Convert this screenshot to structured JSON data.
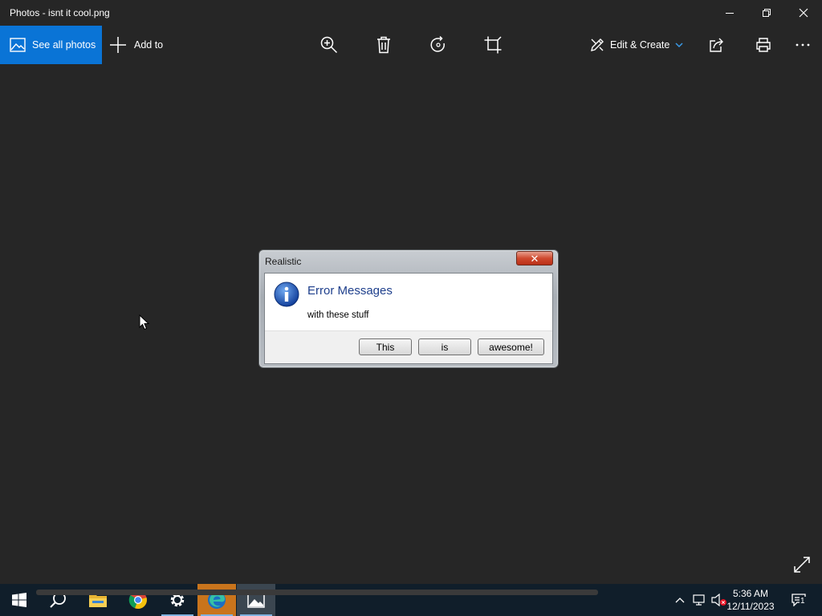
{
  "window": {
    "title": "Photos - isnt it cool.png",
    "controls": [
      "minimize-icon",
      "restore-icon",
      "close-icon"
    ]
  },
  "toolbar": {
    "see_all_label": "See all photos",
    "add_to_label": "Add to",
    "icons": [
      "zoom-in-icon",
      "delete-icon",
      "rotate-icon",
      "crop-icon"
    ],
    "edit_create_label": "Edit & Create",
    "right_icons": [
      "share-icon",
      "print-icon",
      "more-icon"
    ],
    "accent_color": "#0a74d6"
  },
  "dialog": {
    "title": "Realistic",
    "heading": "Error Messages",
    "message": "with these stuff",
    "icon": "info-icon",
    "buttons": [
      "This",
      "is",
      "awesome!"
    ]
  },
  "taskbar": {
    "apps": [
      "windows-start-icon",
      "search-icon",
      "file-explorer-icon",
      "chrome-icon",
      "settings-icon",
      "edge-icon",
      "photos-icon"
    ],
    "clock": {
      "time": "5:36 AM",
      "date": "12/11/2023"
    },
    "notification_count": "1"
  }
}
